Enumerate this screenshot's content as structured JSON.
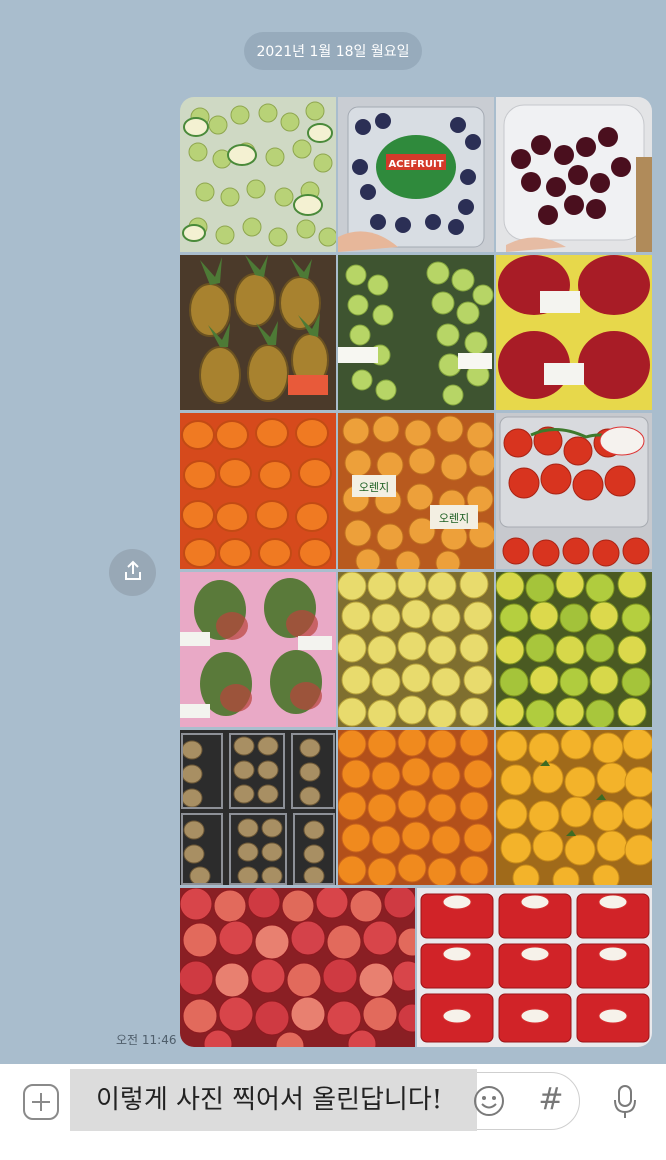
{
  "chat": {
    "date_label": "2021년 1월 18일 월요일",
    "timestamp": "오전 11:46"
  },
  "photo_message": {
    "tiles": [
      {
        "name": "photo-green-grapes",
        "subject": "green grapes"
      },
      {
        "name": "photo-blueberries",
        "subject": "blueberries",
        "label": "ACEFRUIT"
      },
      {
        "name": "photo-cherries",
        "subject": "cherries"
      },
      {
        "name": "photo-pineapples",
        "subject": "pineapples"
      },
      {
        "name": "photo-shine-muscat",
        "subject": "shine muscat grapes"
      },
      {
        "name": "photo-pomegranates",
        "subject": "pomegranates"
      },
      {
        "name": "photo-persimmons",
        "subject": "persimmons"
      },
      {
        "name": "photo-oranges-bagged",
        "subject": "bagged oranges",
        "label": "오렌지"
      },
      {
        "name": "photo-tomatoes",
        "subject": "tomatoes"
      },
      {
        "name": "photo-mangoes",
        "subject": "mangoes"
      },
      {
        "name": "photo-yellow-citrus",
        "subject": "yellow citrus"
      },
      {
        "name": "photo-green-citrus",
        "subject": "green citrus"
      },
      {
        "name": "photo-kiwis",
        "subject": "kiwis"
      },
      {
        "name": "photo-tangerines",
        "subject": "tangerines"
      },
      {
        "name": "photo-hallabong",
        "subject": "hallabong"
      },
      {
        "name": "photo-apples",
        "subject": "apples"
      },
      {
        "name": "photo-strawberries",
        "subject": "strawberries"
      }
    ]
  },
  "input": {
    "text": "이렇게 사진 찍어서 올린답니다!",
    "hash_symbol": "#"
  },
  "colors": {
    "chat_background": "#a9bdcd",
    "date_pill": "#96aaba",
    "input_bar": "#ffffff"
  },
  "icons": [
    "share-icon",
    "plus-icon",
    "emoji-icon",
    "hash-icon",
    "microphone-icon"
  ]
}
